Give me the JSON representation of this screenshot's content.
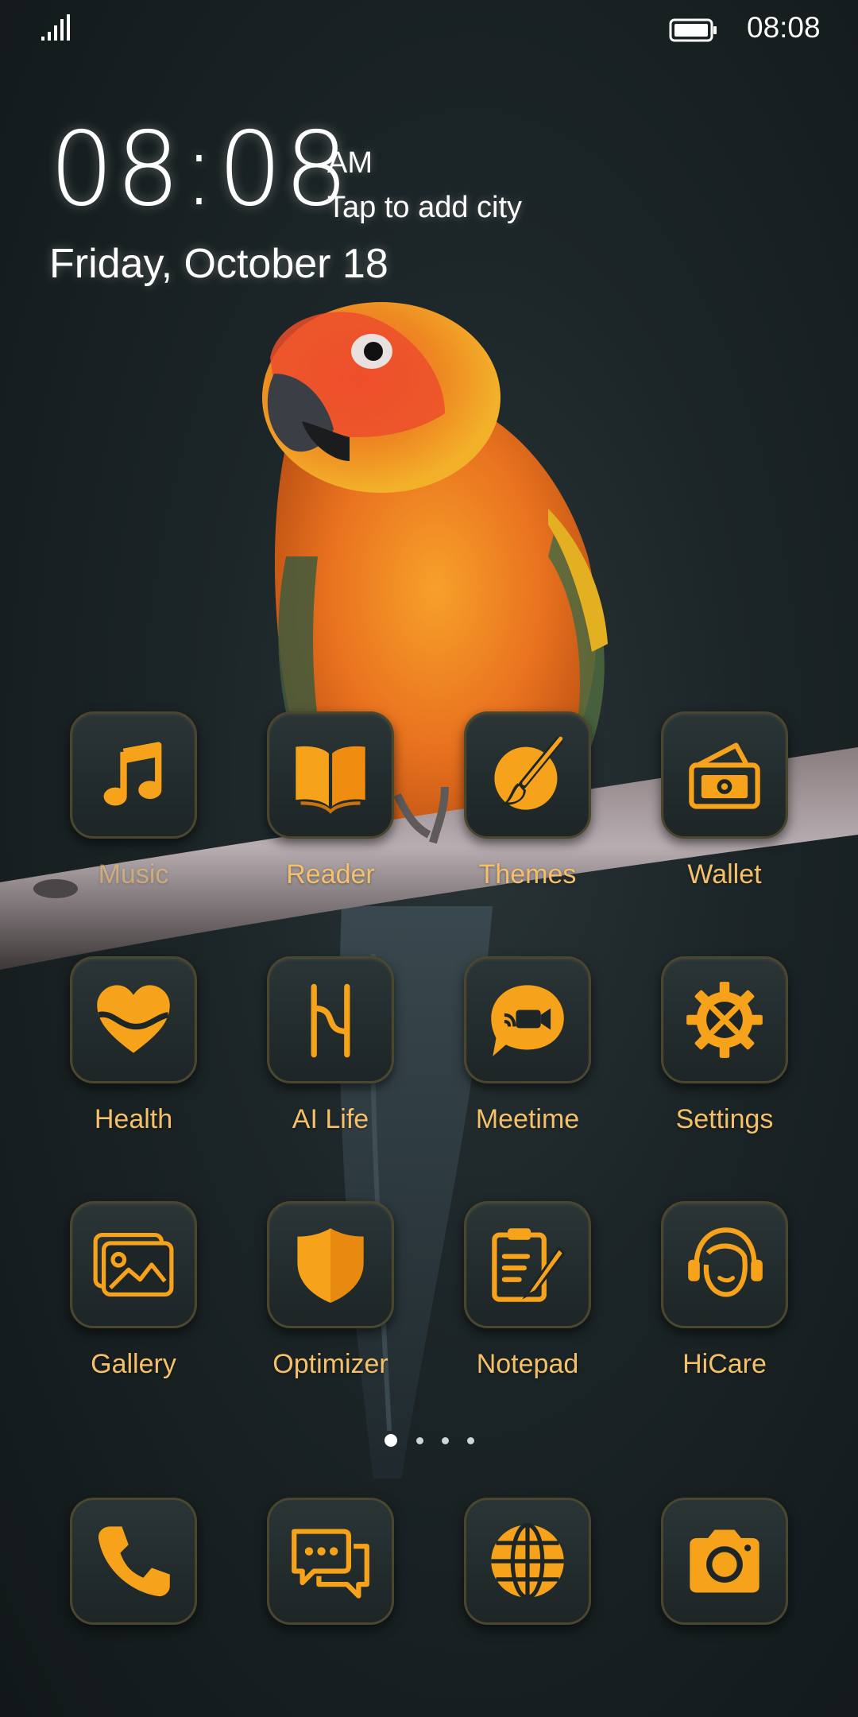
{
  "status_bar": {
    "time": "08:08",
    "signal_icon": "signal-icon",
    "battery_icon": "battery-icon"
  },
  "clock": {
    "time": "08:08",
    "ampm": "AM",
    "city_prompt": "Tap to add city",
    "date": "Friday, October 18"
  },
  "apps": [
    {
      "label": "Music",
      "icon": "music-note-icon"
    },
    {
      "label": "Reader",
      "icon": "book-icon"
    },
    {
      "label": "Themes",
      "icon": "paintbrush-icon"
    },
    {
      "label": "Wallet",
      "icon": "wallet-icon"
    },
    {
      "label": "Health",
      "icon": "heart-icon"
    },
    {
      "label": "AI Life",
      "icon": "ai-life-icon"
    },
    {
      "label": "Meetime",
      "icon": "video-chat-icon"
    },
    {
      "label": "Settings",
      "icon": "gear-icon"
    },
    {
      "label": "Gallery",
      "icon": "gallery-icon"
    },
    {
      "label": "Optimizer",
      "icon": "shield-icon"
    },
    {
      "label": "Notepad",
      "icon": "notepad-icon"
    },
    {
      "label": "HiCare",
      "icon": "headset-icon"
    }
  ],
  "page_indicator": {
    "pages": 4,
    "current": 1
  },
  "dock": [
    {
      "icon": "phone-icon"
    },
    {
      "icon": "messages-icon"
    },
    {
      "icon": "browser-globe-icon"
    },
    {
      "icon": "camera-icon"
    }
  ],
  "colors": {
    "accent": "#f7a21b",
    "label": "#f4c06a",
    "background": "#1c2527"
  }
}
